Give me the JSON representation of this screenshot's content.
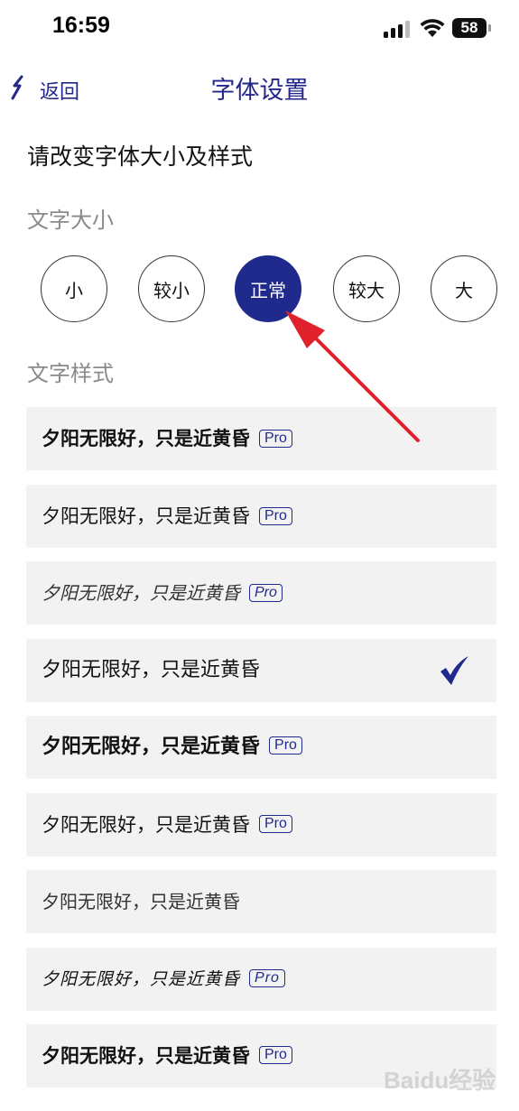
{
  "status_bar": {
    "time": "16:59",
    "battery_level": "58",
    "icons": [
      "signal-icon",
      "wifi-icon",
      "battery-icon"
    ]
  },
  "nav": {
    "back_label": "返回",
    "title": "字体设置",
    "back_icon": "back-icon"
  },
  "instruction": "请改变字体大小及样式",
  "size_section": {
    "label": "文字大小",
    "options": [
      "小",
      "较小",
      "正常",
      "较大",
      "大"
    ],
    "selected": "正常"
  },
  "style_section": {
    "label": "文字样式",
    "rows": [
      {
        "text": "夕阳无限好，只是近黄昏",
        "badge": "Pro"
      },
      {
        "text": "夕阳无限好，只是近黄昏",
        "badge": "Pro"
      },
      {
        "text": "夕阳无限好，只是近黄昏",
        "badge": "Pro"
      },
      {
        "text": "夕阳无限好，只是近黄昏",
        "selected": true
      },
      {
        "text": "夕阳无限好，只是近黄昏",
        "badge": "Pro"
      },
      {
        "text": "夕阳无限好，只是近黄昏",
        "badge": "Pro"
      },
      {
        "text": "夕阳无限好，只是近黄昏"
      },
      {
        "text": "夕阳无限好，只是近黄昏",
        "badge": "Pro"
      },
      {
        "text": "夕阳无限好，只是近黄昏",
        "badge": "Pro"
      }
    ]
  },
  "colors": {
    "accent": "#1f2a8c",
    "nav_text": "#23278a",
    "annotation_arrow": "#e0202a",
    "row_background": "#f2f2f2",
    "section_label": "#8a8a8a"
  },
  "watermark": "Baidu经验"
}
